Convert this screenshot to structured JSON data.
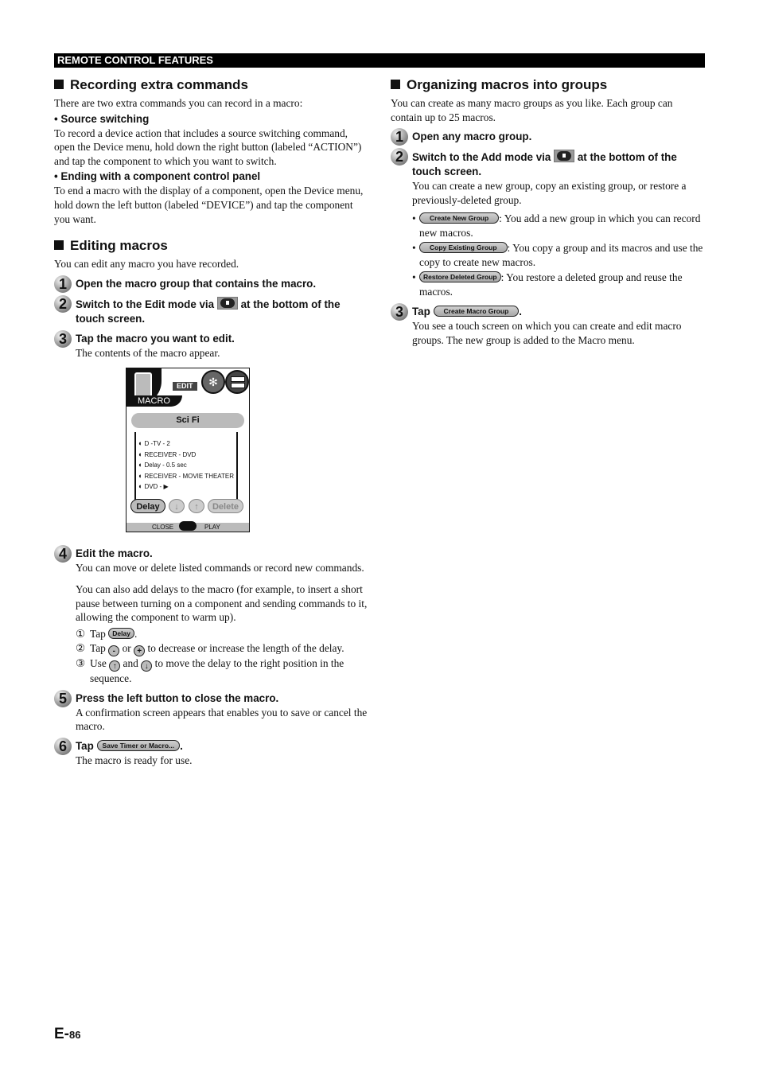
{
  "header": {
    "section_label": "REMOTE CONTROL FEATURES"
  },
  "recording": {
    "title": "Recording extra commands",
    "intro": "There are two extra commands you can record in a macro:",
    "items": [
      {
        "label": "• Source switching",
        "text": "To record a device action that includes a source switching command, open the Device menu, hold down the right button (labeled “ACTION”) and tap the component to which you want to switch."
      },
      {
        "label": "• Ending with a component control panel",
        "text": "To end a macro with the display of a component, open the Device menu, hold down the left button (labeled “DEVICE”) and tap the component you want."
      }
    ]
  },
  "editing": {
    "title": "Editing macros",
    "intro": "You can edit any macro you have recorded.",
    "steps": [
      {
        "num": "1",
        "title": "Open the macro group that contains the macro."
      },
      {
        "num": "2",
        "title_pre": "Switch to the Edit mode via",
        "title_post": "at the bottom of the touch screen.",
        "icon": "mode-button-icon"
      },
      {
        "num": "3",
        "title": "Tap the macro you want to edit.",
        "text": "The contents of the macro appear."
      },
      {
        "num": "4",
        "title": "Edit the macro.",
        "text": "You can move or delete listed commands or record new commands.",
        "text2": "You can also add delays to the macro (for example, to insert a short pause between turning on a component and sending commands to it, allowing the component to warm up).",
        "substeps": [
          {
            "n": "①",
            "pre": "Tap",
            "btn": "Delay",
            "post": "."
          },
          {
            "n": "②",
            "pre": "Tap",
            "icon1": "-",
            "mid": "or",
            "icon2": "+",
            "post": "to decrease or increase the length of the delay."
          },
          {
            "n": "③",
            "pre": "Use",
            "icon1": "↑",
            "mid": "and",
            "icon2": "↓",
            "post": "to move the delay to the right position in the sequence."
          }
        ]
      },
      {
        "num": "5",
        "title": "Press the left button to close the macro.",
        "text": "A confirmation screen appears that enables you to save or cancel the macro."
      },
      {
        "num": "6",
        "title_pre": "Tap",
        "btn": "Save Timer or Macro...",
        "title_post": ".",
        "text": "The macro is ready for use."
      }
    ]
  },
  "device_screen": {
    "mode_label": "EDIT",
    "menu_label": "MACRO",
    "group_title": "Sci Fi",
    "commands": [
      "D -TV - 2",
      "RECEIVER - DVD",
      "Delay - 0.5 sec",
      "RECEIVER - MOVIE THEATER",
      "DVD - ▶"
    ],
    "buttons": {
      "delay": "Delay",
      "down": "↓",
      "up": "↑",
      "delete": "Delete"
    },
    "bottom": {
      "left": "CLOSE",
      "right": "PLAY"
    }
  },
  "organizing": {
    "title": "Organizing macros into groups",
    "intro": "You can create as many macro groups as you like. Each group can contain up to 25 macros.",
    "steps": [
      {
        "num": "1",
        "title": "Open any macro group."
      },
      {
        "num": "2",
        "title_pre": "Switch to the Add mode via",
        "title_post": "at the bottom of the touch screen.",
        "text": "You can create a new group, copy an existing group, or restore a previously-deleted group.",
        "options": [
          {
            "btn": "Create New Group",
            "text": ": You add a new group in which you can record new macros."
          },
          {
            "btn": "Copy Existing Group",
            "text": ": You copy a group and its macros and use the copy to create new macros."
          },
          {
            "btn": "Restore Deleted Group",
            "text": ": You restore a deleted group and reuse the macros."
          }
        ]
      },
      {
        "num": "3",
        "title_pre": "Tap",
        "btn": "Create Macro Group",
        "title_post": ".",
        "text": "You see a touch screen on which you can create and edit macro groups. The new group is added to the Macro menu."
      }
    ]
  },
  "footer": {
    "page_prefix": "E-",
    "page_number": "86"
  }
}
